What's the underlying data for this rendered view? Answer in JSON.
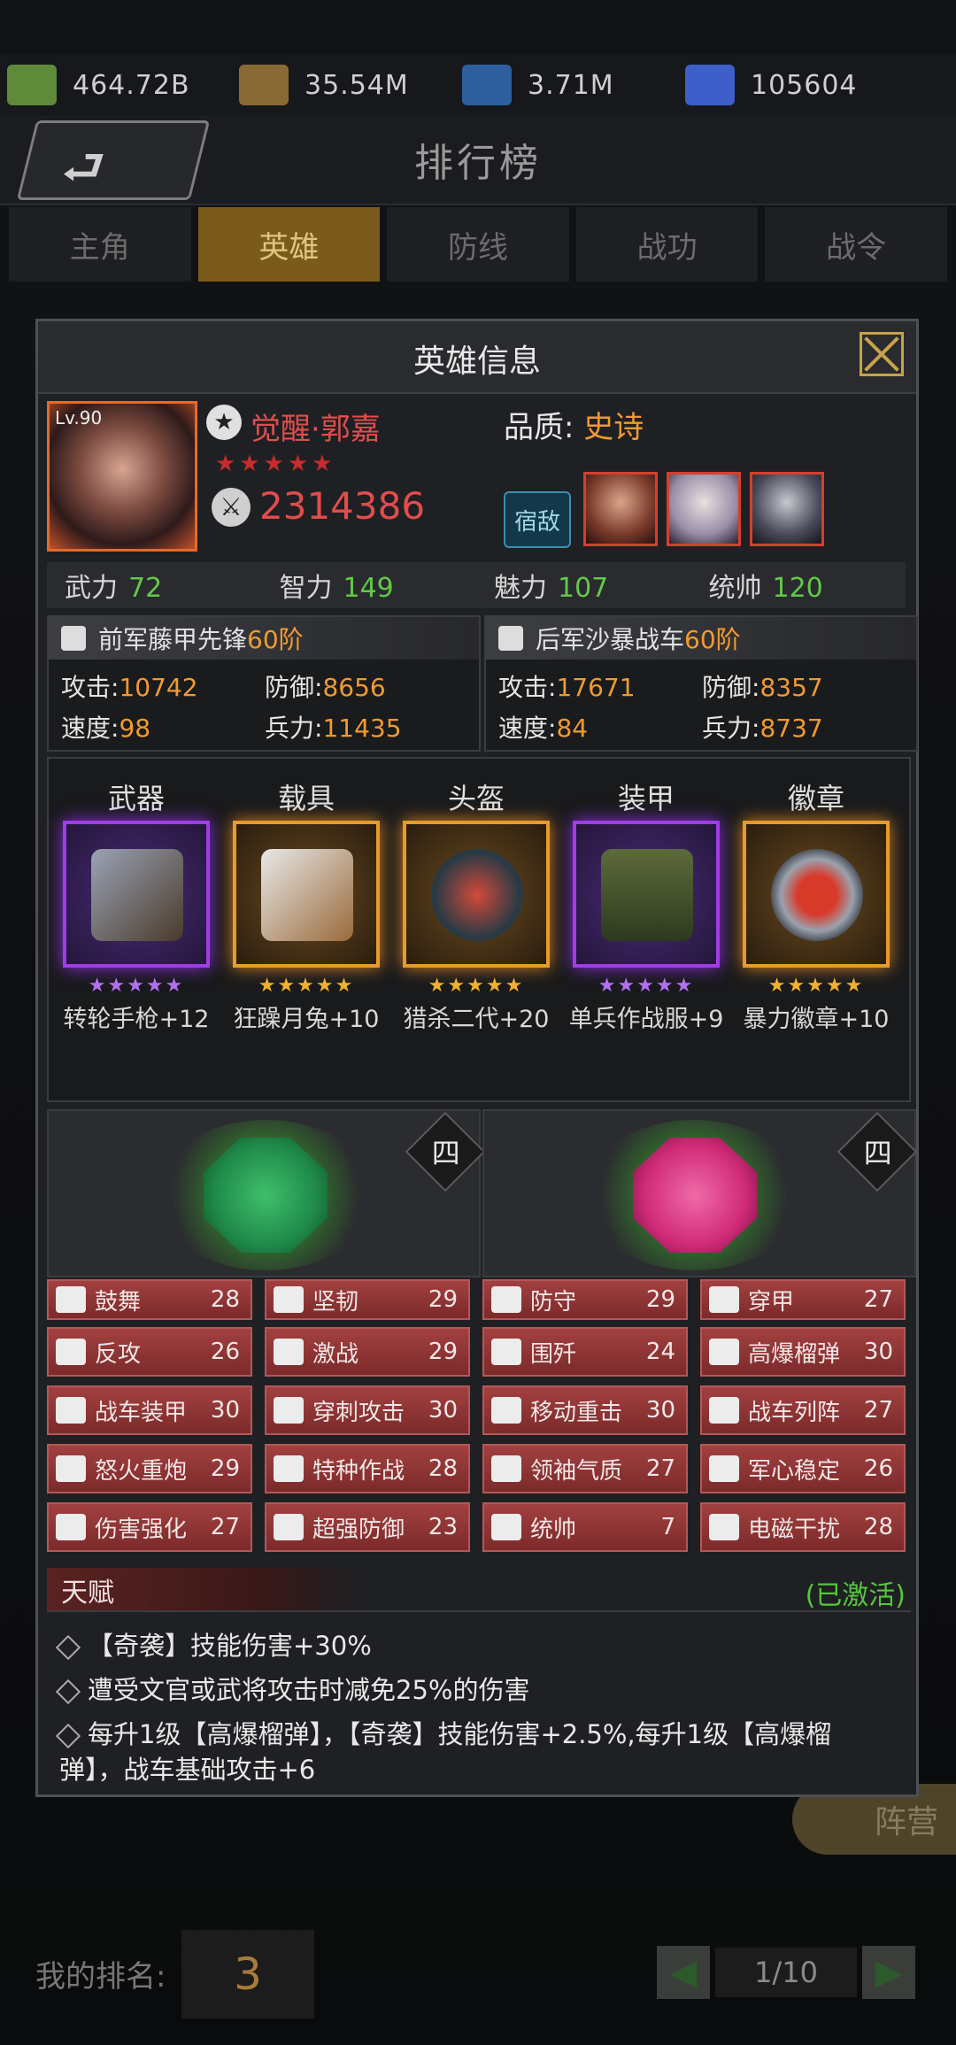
{
  "resources": [
    {
      "icon": "cash-icon",
      "value": "464.72B"
    },
    {
      "icon": "wheat-icon",
      "value": "35.54M"
    },
    {
      "icon": "lightning-icon",
      "value": "3.71M"
    },
    {
      "icon": "diamond-icon",
      "value": "105604"
    }
  ],
  "header": {
    "title": "排行榜"
  },
  "tabs": [
    "主角",
    "英雄",
    "防线",
    "战功",
    "战令"
  ],
  "active_tab": "英雄",
  "bottom": {
    "my_rank_label": "我的排名:",
    "my_rank": "3",
    "page": "1/10",
    "camp_label": "阵营"
  },
  "modal": {
    "title": "英雄信息",
    "hero": {
      "level": "Lv.90",
      "name": "觉醒·郭嘉",
      "stars": 5,
      "power": "2314386",
      "quality_label": "品质:",
      "quality": "史诗",
      "fetter_label": "宿敌"
    },
    "attributes": [
      {
        "label": "武力",
        "value": "72"
      },
      {
        "label": "智力",
        "value": "149"
      },
      {
        "label": "魅力",
        "value": "107"
      },
      {
        "label": "统帅",
        "value": "120"
      }
    ],
    "troops": [
      {
        "name": "前军藤甲先锋",
        "level": "60阶",
        "attack_label": "攻击:",
        "attack": "10742",
        "defense_label": "防御:",
        "defense": "8656",
        "speed_label": "速度:",
        "speed": "98",
        "troops_label": "兵力:",
        "troops": "11435"
      },
      {
        "name": "后军沙暴战车",
        "level": "60阶",
        "attack_label": "攻击:",
        "attack": "17671",
        "defense_label": "防御:",
        "defense": "8357",
        "speed_label": "速度:",
        "speed": "84",
        "troops_label": "兵力:",
        "troops": "8737"
      }
    ],
    "equipment": [
      {
        "slot": "武器",
        "name": "转轮手枪+12",
        "rarity": "purple",
        "star_color": "#b070f0"
      },
      {
        "slot": "载具",
        "name": "狂躁月兔+10",
        "rarity": "orange",
        "star_color": "#f0b030"
      },
      {
        "slot": "头盔",
        "name": "猎杀二代+20",
        "rarity": "orange",
        "star_color": "#f0b030"
      },
      {
        "slot": "装甲",
        "name": "单兵作战服+9",
        "rarity": "purple",
        "star_color": "#b070f0"
      },
      {
        "slot": "徽章",
        "name": "暴力徽章+10",
        "rarity": "orange",
        "star_color": "#f0b030"
      }
    ],
    "gems": [
      {
        "tier": "四",
        "color": "#1f8a4a"
      },
      {
        "tier": "四",
        "color": "#d02a78"
      }
    ],
    "skills": [
      {
        "name": "鼓舞",
        "value": "28"
      },
      {
        "name": "坚韧",
        "value": "29"
      },
      {
        "name": "防守",
        "value": "29"
      },
      {
        "name": "穿甲",
        "value": "27"
      },
      {
        "name": "反攻",
        "value": "26"
      },
      {
        "name": "激战",
        "value": "29"
      },
      {
        "name": "围歼",
        "value": "24"
      },
      {
        "name": "高爆榴弹",
        "value": "30"
      },
      {
        "name": "战车装甲",
        "value": "30"
      },
      {
        "name": "穿刺攻击",
        "value": "30"
      },
      {
        "name": "移动重击",
        "value": "30"
      },
      {
        "name": "战车列阵",
        "value": "27"
      },
      {
        "name": "怒火重炮",
        "value": "29"
      },
      {
        "name": "特种作战",
        "value": "28"
      },
      {
        "name": "领袖气质",
        "value": "27"
      },
      {
        "name": "军心稳定",
        "value": "26"
      },
      {
        "name": "伤害强化",
        "value": "27"
      },
      {
        "name": "超强防御",
        "value": "23"
      },
      {
        "name": "统帅",
        "value": "7"
      },
      {
        "name": "电磁干扰",
        "value": "28"
      }
    ],
    "talent": {
      "label": "天赋",
      "status": "(已激活)",
      "lines": [
        "【奇袭】技能伤害+30%",
        "遭受文官或武将攻击时减免25%的伤害",
        "每升1级【高爆榴弹】，【奇袭】技能伤害+2.5%,每升1级【高爆榴弹】，战车基础攻击+6"
      ]
    }
  }
}
